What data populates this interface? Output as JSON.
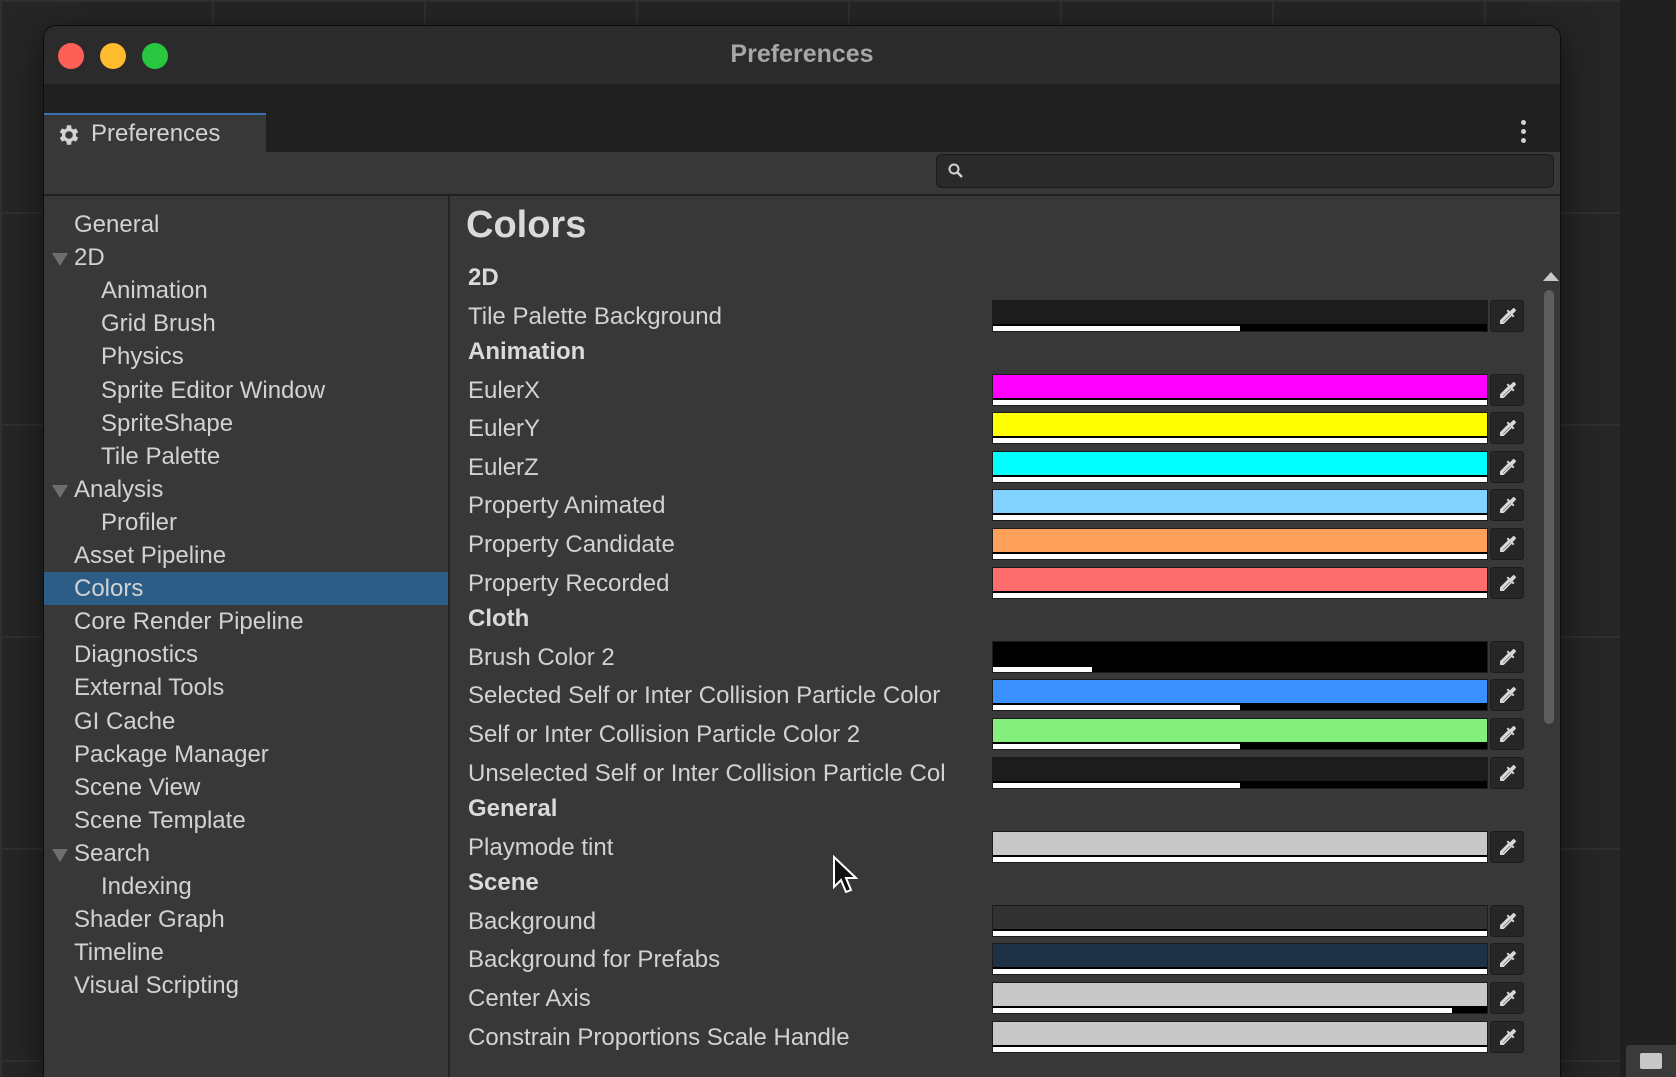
{
  "window": {
    "title": "Preferences"
  },
  "tab": {
    "label": "Preferences"
  },
  "search": {
    "placeholder": "",
    "value": ""
  },
  "sidebar": {
    "items": [
      {
        "label": "General",
        "level": 0,
        "expanded": null,
        "selected": false
      },
      {
        "label": "2D",
        "level": 0,
        "expanded": true,
        "selected": false
      },
      {
        "label": "Animation",
        "level": 1,
        "expanded": null,
        "selected": false
      },
      {
        "label": "Grid Brush",
        "level": 1,
        "expanded": null,
        "selected": false
      },
      {
        "label": "Physics",
        "level": 1,
        "expanded": null,
        "selected": false
      },
      {
        "label": "Sprite Editor Window",
        "level": 1,
        "expanded": null,
        "selected": false
      },
      {
        "label": "SpriteShape",
        "level": 1,
        "expanded": null,
        "selected": false
      },
      {
        "label": "Tile Palette",
        "level": 1,
        "expanded": null,
        "selected": false
      },
      {
        "label": "Analysis",
        "level": 0,
        "expanded": true,
        "selected": false
      },
      {
        "label": "Profiler",
        "level": 1,
        "expanded": null,
        "selected": false
      },
      {
        "label": "Asset Pipeline",
        "level": 0,
        "expanded": null,
        "selected": false
      },
      {
        "label": "Colors",
        "level": 0,
        "expanded": null,
        "selected": true
      },
      {
        "label": "Core Render Pipeline",
        "level": 0,
        "expanded": null,
        "selected": false
      },
      {
        "label": "Diagnostics",
        "level": 0,
        "expanded": null,
        "selected": false
      },
      {
        "label": "External Tools",
        "level": 0,
        "expanded": null,
        "selected": false
      },
      {
        "label": "GI Cache",
        "level": 0,
        "expanded": null,
        "selected": false
      },
      {
        "label": "Package Manager",
        "level": 0,
        "expanded": null,
        "selected": false
      },
      {
        "label": "Scene View",
        "level": 0,
        "expanded": null,
        "selected": false
      },
      {
        "label": "Scene Template",
        "level": 0,
        "expanded": null,
        "selected": false
      },
      {
        "label": "Search",
        "level": 0,
        "expanded": true,
        "selected": false
      },
      {
        "label": "Indexing",
        "level": 1,
        "expanded": null,
        "selected": false
      },
      {
        "label": "Shader Graph",
        "level": 0,
        "expanded": null,
        "selected": false
      },
      {
        "label": "Timeline",
        "level": 0,
        "expanded": null,
        "selected": false
      },
      {
        "label": "Visual Scripting",
        "level": 0,
        "expanded": null,
        "selected": false
      }
    ]
  },
  "content": {
    "title": "Colors",
    "rows": [
      {
        "kind": "header",
        "label": "2D"
      },
      {
        "kind": "color",
        "label": "Tile Palette Background",
        "color": "#1c1c1c",
        "alpha": 0.5
      },
      {
        "kind": "header",
        "label": "Animation"
      },
      {
        "kind": "color",
        "label": "EulerX",
        "color": "#ff00ff",
        "alpha": 1.0
      },
      {
        "kind": "color",
        "label": "EulerY",
        "color": "#ffff00",
        "alpha": 1.0
      },
      {
        "kind": "color",
        "label": "EulerZ",
        "color": "#00ffff",
        "alpha": 1.0
      },
      {
        "kind": "color",
        "label": "Property Animated",
        "color": "#82d2ff",
        "alpha": 1.0
      },
      {
        "kind": "color",
        "label": "Property Candidate",
        "color": "#ffa05a",
        "alpha": 1.0
      },
      {
        "kind": "color",
        "label": "Property Recorded",
        "color": "#ff6e6e",
        "alpha": 1.0
      },
      {
        "kind": "header",
        "label": "Cloth"
      },
      {
        "kind": "color",
        "label": "Brush Color 2",
        "color": "#000000",
        "alpha": 0.2
      },
      {
        "kind": "color",
        "label": "Selected Self or Inter Collision Particle Color",
        "color": "#3a90ff",
        "alpha": 0.5
      },
      {
        "kind": "color",
        "label": "Self or Inter Collision Particle Color 2",
        "color": "#84ef7c",
        "alpha": 0.5
      },
      {
        "kind": "color",
        "label": "Unselected Self or Inter Collision Particle Color",
        "color": "#1c1c1c",
        "alpha": 0.5
      },
      {
        "kind": "header",
        "label": "General"
      },
      {
        "kind": "color",
        "label": "Playmode tint",
        "color": "#c8c8c8",
        "alpha": 1.0
      },
      {
        "kind": "header",
        "label": "Scene"
      },
      {
        "kind": "color",
        "label": "Background",
        "color": "#323232",
        "alpha": 1.0
      },
      {
        "kind": "color",
        "label": "Background for Prefabs",
        "color": "#1e3046",
        "alpha": 1.0
      },
      {
        "kind": "color",
        "label": "Center Axis",
        "color": "#c8c8c8",
        "alpha": 0.93
      },
      {
        "kind": "color",
        "label": "Constrain Proportions Scale Handle",
        "color": "#c8c8c8",
        "alpha": 1.0
      }
    ]
  },
  "colors": {
    "selection": "#2c5d87",
    "panel": "#383838",
    "accent": "#3a72b0"
  }
}
